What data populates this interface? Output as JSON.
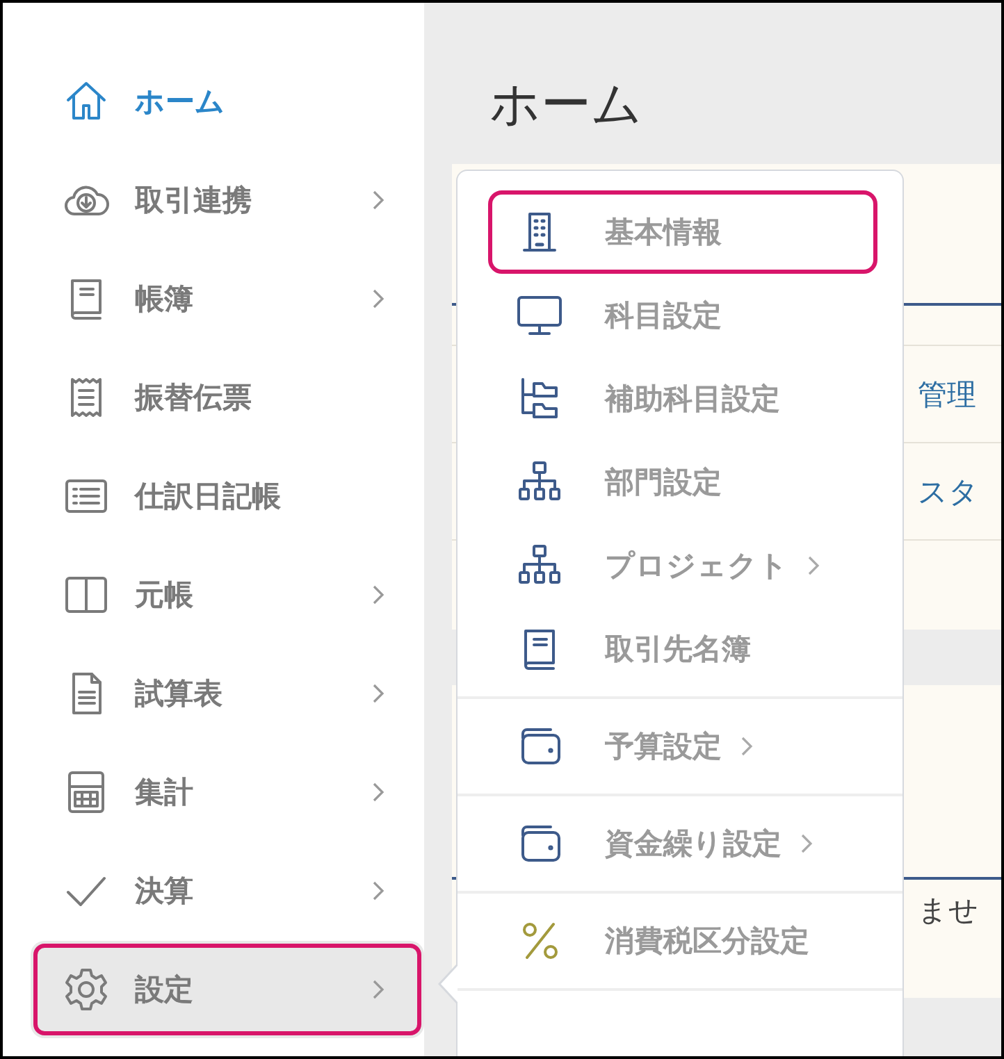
{
  "sidebar": {
    "items": [
      {
        "label": "ホーム",
        "selected": true,
        "has_submenu": false,
        "expanded": false,
        "highlighted": false
      },
      {
        "label": "取引連携",
        "selected": false,
        "has_submenu": true,
        "expanded": false,
        "highlighted": false
      },
      {
        "label": "帳簿",
        "selected": false,
        "has_submenu": true,
        "expanded": false,
        "highlighted": false
      },
      {
        "label": "振替伝票",
        "selected": false,
        "has_submenu": false,
        "expanded": false,
        "highlighted": false
      },
      {
        "label": "仕訳日記帳",
        "selected": false,
        "has_submenu": false,
        "expanded": false,
        "highlighted": false
      },
      {
        "label": "元帳",
        "selected": false,
        "has_submenu": true,
        "expanded": false,
        "highlighted": false
      },
      {
        "label": "試算表",
        "selected": false,
        "has_submenu": true,
        "expanded": false,
        "highlighted": false
      },
      {
        "label": "集計",
        "selected": false,
        "has_submenu": true,
        "expanded": false,
        "highlighted": false
      },
      {
        "label": "決算",
        "selected": false,
        "has_submenu": true,
        "expanded": false,
        "highlighted": false
      },
      {
        "label": "設定",
        "selected": false,
        "has_submenu": true,
        "expanded": true,
        "highlighted": true
      }
    ]
  },
  "main": {
    "title": "ホーム",
    "rows": [
      "管理",
      "スタ"
    ],
    "footer_text": "ませ"
  },
  "settings_menu": {
    "groups": [
      [
        {
          "label": "基本情報",
          "has_submenu": false,
          "highlighted": true
        },
        {
          "label": "科目設定",
          "has_submenu": false,
          "highlighted": false
        },
        {
          "label": "補助科目設定",
          "has_submenu": false,
          "highlighted": false
        },
        {
          "label": "部門設定",
          "has_submenu": false,
          "highlighted": false
        },
        {
          "label": "プロジェクト",
          "has_submenu": true,
          "highlighted": false
        },
        {
          "label": "取引先名簿",
          "has_submenu": false,
          "highlighted": false
        }
      ],
      [
        {
          "label": "予算設定",
          "has_submenu": true,
          "highlighted": false
        }
      ],
      [
        {
          "label": "資金繰り設定",
          "has_submenu": true,
          "highlighted": false
        }
      ],
      [
        {
          "label": "消費税区分設定",
          "has_submenu": false,
          "highlighted": false
        }
      ]
    ]
  }
}
